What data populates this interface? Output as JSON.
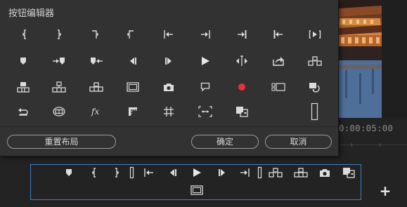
{
  "dialog": {
    "title": "按钮编辑器",
    "buttons": {
      "reset": "重置布局",
      "ok": "确定",
      "cancel": "取消"
    }
  },
  "monitor": {
    "timecode": "0:00:05:00"
  },
  "colors": {
    "accent_border": "#3f7fc4",
    "record_red": "#e8323a",
    "dialog_bg": "#323232",
    "page_bg": "#232323"
  },
  "icons": {
    "grid_row1": [
      "mark-in-icon",
      "mark-out-icon",
      "mark-clip-in-icon",
      "mark-clip-out-icon",
      "go-to-in-icon",
      "go-to-out-icon",
      "go-to-out-point-icon",
      "go-to-in-point-icon",
      "play-in-to-out-icon"
    ],
    "grid_row2": [
      "add-marker-icon",
      "go-to-next-marker-icon",
      "go-to-previous-marker-icon",
      "step-back-icon",
      "step-forward-icon",
      "play-icon",
      "trim-edit-icon",
      "export-icon",
      "insert-icon"
    ],
    "grid_row3": [
      "lift-icon",
      "extract-icon",
      "overwrite-icon",
      "safe-margins-icon",
      "export-frame-icon",
      "comment-icon",
      "record-icon",
      "multi-camera-icon",
      "loop-icon"
    ],
    "grid_row4": [
      "restore-icon",
      "vr-video-icon",
      "fx-icon",
      "ruler-icon",
      "grid-icon",
      "fit-icon",
      "compare-view-icon",
      "spacer-icon"
    ],
    "transport": [
      "add-marker-icon",
      "mark-in-icon",
      "mark-out-icon",
      "spacer-icon",
      "go-to-in-icon",
      "step-back-icon",
      "play-icon",
      "step-forward-icon",
      "go-to-out-icon",
      "spacer-icon",
      "insert-icon",
      "overwrite-icon",
      "export-frame-icon",
      "compare-view-icon",
      "safe-margins-icon"
    ]
  }
}
